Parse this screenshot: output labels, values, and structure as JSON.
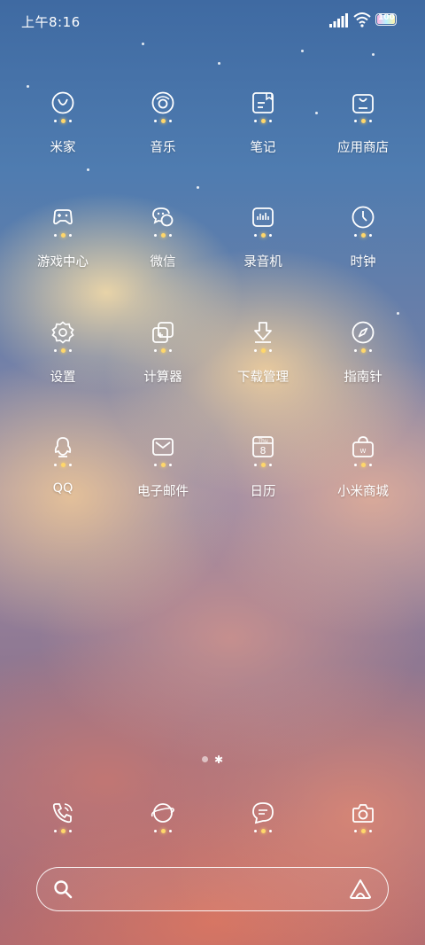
{
  "status_bar": {
    "time": "上午8:16",
    "signal_icon": "signal-bars-icon",
    "wifi_icon": "wifi-icon",
    "battery_icon": "battery-icon",
    "battery_level": 100,
    "battery_text": "100"
  },
  "apps": [
    {
      "label": "米家",
      "icon": "mijia-icon"
    },
    {
      "label": "音乐",
      "icon": "music-icon"
    },
    {
      "label": "笔记",
      "icon": "notes-icon"
    },
    {
      "label": "应用商店",
      "icon": "app-store-icon"
    },
    {
      "label": "游戏中心",
      "icon": "gamepad-icon"
    },
    {
      "label": "微信",
      "icon": "wechat-icon"
    },
    {
      "label": "录音机",
      "icon": "recorder-icon"
    },
    {
      "label": "时钟",
      "icon": "clock-icon"
    },
    {
      "label": "设置",
      "icon": "gear-icon"
    },
    {
      "label": "计算器",
      "icon": "calculator-icon"
    },
    {
      "label": "下载管理",
      "icon": "download-icon"
    },
    {
      "label": "指南针",
      "icon": "compass-icon"
    },
    {
      "label": "QQ",
      "icon": "qq-icon"
    },
    {
      "label": "电子邮件",
      "icon": "mail-icon"
    },
    {
      "label": "日历",
      "icon": "calendar-icon"
    },
    {
      "label": "小米商城",
      "icon": "mi-store-icon"
    }
  ],
  "calendar_icon_text": {
    "weekday": "Thu",
    "day": "8"
  },
  "mi_store_icon_text": "W",
  "page_indicator": {
    "pages": 2,
    "current": 2
  },
  "dock": [
    {
      "icon": "phone-icon"
    },
    {
      "icon": "browser-planet-icon"
    },
    {
      "icon": "messages-icon"
    },
    {
      "icon": "camera-icon"
    }
  ],
  "search": {
    "placeholder": "",
    "search_icon": "search-icon",
    "assistant_icon": "assistant-icon"
  },
  "colors": {
    "accent_dot": "#ffd76a",
    "text": "#ffffff"
  }
}
